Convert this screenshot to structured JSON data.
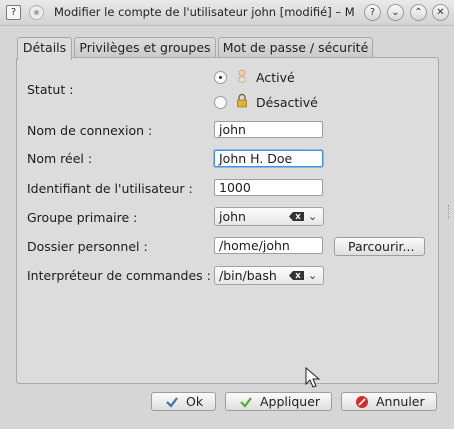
{
  "window": {
    "title": "Modifier le compte de l'utilisateur john [modifié] – Mo...",
    "help_label": "?",
    "buttons": {
      "help": "?",
      "minimize": "⌄",
      "maximize": "⌃",
      "close": "✕"
    }
  },
  "tabs": [
    {
      "label": "Détails",
      "active": true
    },
    {
      "label": "Privilèges et groupes",
      "active": false
    },
    {
      "label": "Mot de passe / sécurité",
      "active": false
    }
  ],
  "form": {
    "statut_label": "Statut :",
    "statut_options": [
      {
        "label": "Activé",
        "selected": true,
        "icon": "user-unlocked-icon"
      },
      {
        "label": "Désactivé",
        "selected": false,
        "icon": "lock-icon"
      }
    ],
    "login_label": "Nom de connexion :",
    "login_value": "john",
    "realname_label": "Nom réel :",
    "realname_value": "John H. Doe",
    "uid_label": "Identifiant de l'utilisateur :",
    "uid_value": "1000",
    "group_label": "Groupe primaire :",
    "group_value": "john",
    "home_label": "Dossier personnel :",
    "home_value": "/home/john",
    "browse_label": "Parcourir...",
    "shell_label": "Interpréteur de commandes :",
    "shell_value": "/bin/bash"
  },
  "footer": {
    "ok_label": "Ok",
    "apply_label": "Appliquer",
    "cancel_label": "Annuler"
  },
  "colors": {
    "focus": "#4a90d9",
    "ok_icon": "#3a6fb0",
    "apply_icon": "#4caf2b",
    "cancel_icon": "#d62b2b"
  }
}
